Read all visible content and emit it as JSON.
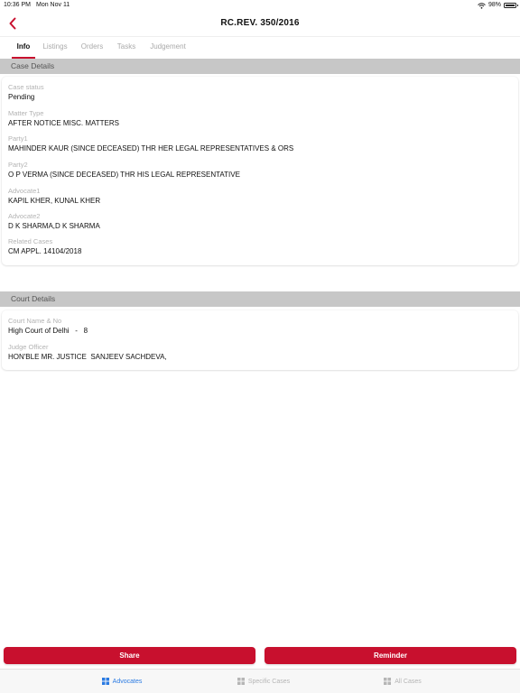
{
  "status_bar": {
    "time": "10:36 PM",
    "date": "Mon Nov 11",
    "battery": "98%",
    "battery_level": 0.98
  },
  "nav": {
    "title": "RC.REV. 350/2016",
    "back_icon": "chevron-left-icon"
  },
  "tabs": [
    {
      "label": "Info",
      "active": true
    },
    {
      "label": "Listings",
      "active": false
    },
    {
      "label": "Orders",
      "active": false
    },
    {
      "label": "Tasks",
      "active": false
    },
    {
      "label": "Judgement",
      "active": false
    }
  ],
  "case_details": {
    "header": "Case Details",
    "fields": [
      {
        "label": "Case status",
        "value": "Pending"
      },
      {
        "label": "Matter Type",
        "value": "AFTER NOTICE MISC. MATTERS"
      },
      {
        "label": "Party1",
        "value": "MAHINDER KAUR (SINCE DECEASED) THR HER LEGAL REPRESENTATIVES & ORS"
      },
      {
        "label": "Party2",
        "value": "O P VERMA (SINCE DECEASED) THR HIS LEGAL REPRESENTATIVE"
      },
      {
        "label": "Advocate1",
        "value": "KAPIL KHER, KUNAL KHER"
      },
      {
        "label": "Advocate2",
        "value": "D K SHARMA,D K SHARMA"
      },
      {
        "label": "Related Cases",
        "value": "CM APPL. 14104/2018"
      }
    ]
  },
  "court_details": {
    "header": "Court Details",
    "fields": [
      {
        "label": "Court Name & No",
        "value": "High Court of Delhi   -   8"
      },
      {
        "label": "Judge Officer",
        "value": "HON'BLE MR. JUSTICE  SANJEEV SACHDEVA,"
      }
    ]
  },
  "actions": {
    "share_label": "Share",
    "reminder_label": "Reminder",
    "color": "#c8102e"
  },
  "tab_bar": {
    "items": [
      {
        "label": "Advocates",
        "icon": "grid-icon",
        "active": true
      },
      {
        "label": "Specific Cases",
        "icon": "grid-icon",
        "active": false
      },
      {
        "label": "All Cases",
        "icon": "grid-icon",
        "active": false
      }
    ],
    "active_color": "#2a7ae2"
  }
}
